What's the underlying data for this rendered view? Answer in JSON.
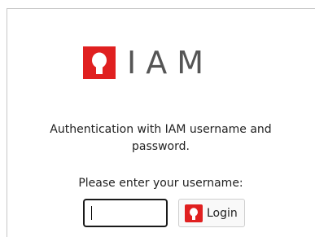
{
  "brand": {
    "name": "IAM",
    "logo_icon": "iam-logo-icon",
    "logo_color": "#e02020"
  },
  "intro": {
    "line1": "Authentication with IAM username and",
    "line2": "password."
  },
  "form": {
    "prompt": "Please enter your username:",
    "username_value": "",
    "login_label": "Login",
    "login_icon": "iam-logo-icon"
  }
}
